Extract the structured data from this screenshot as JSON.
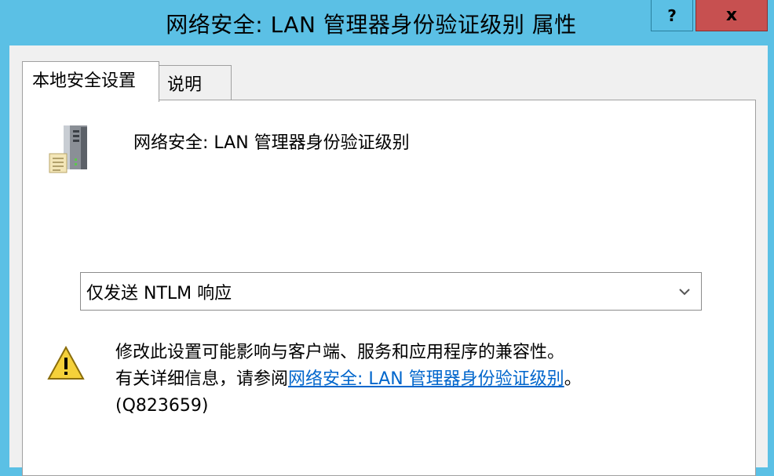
{
  "window": {
    "title": "网络安全: LAN 管理器身份验证级别 属性",
    "help_button": "?",
    "close_button": "x"
  },
  "tabs": [
    {
      "label": "本地安全设置",
      "active": true
    },
    {
      "label": "说明",
      "active": false
    }
  ],
  "policy": {
    "name": "网络安全: LAN 管理器身份验证级别",
    "icon": "server-icon"
  },
  "setting": {
    "selected_value": "仅发送 NTLM 响应"
  },
  "warning": {
    "icon": "warning-icon",
    "line1": "修改此设置可能影响与客户端、服务和应用程序的兼容性。",
    "line2_prefix": "有关详细信息，请参阅",
    "link_text": "网络安全: LAN 管理器身份验证级别",
    "line2_suffix": "。",
    "line3": "(Q823659)"
  },
  "colors": {
    "titlebar": "#5bc0e5",
    "close_button": "#c75050",
    "link": "#0066cc"
  }
}
